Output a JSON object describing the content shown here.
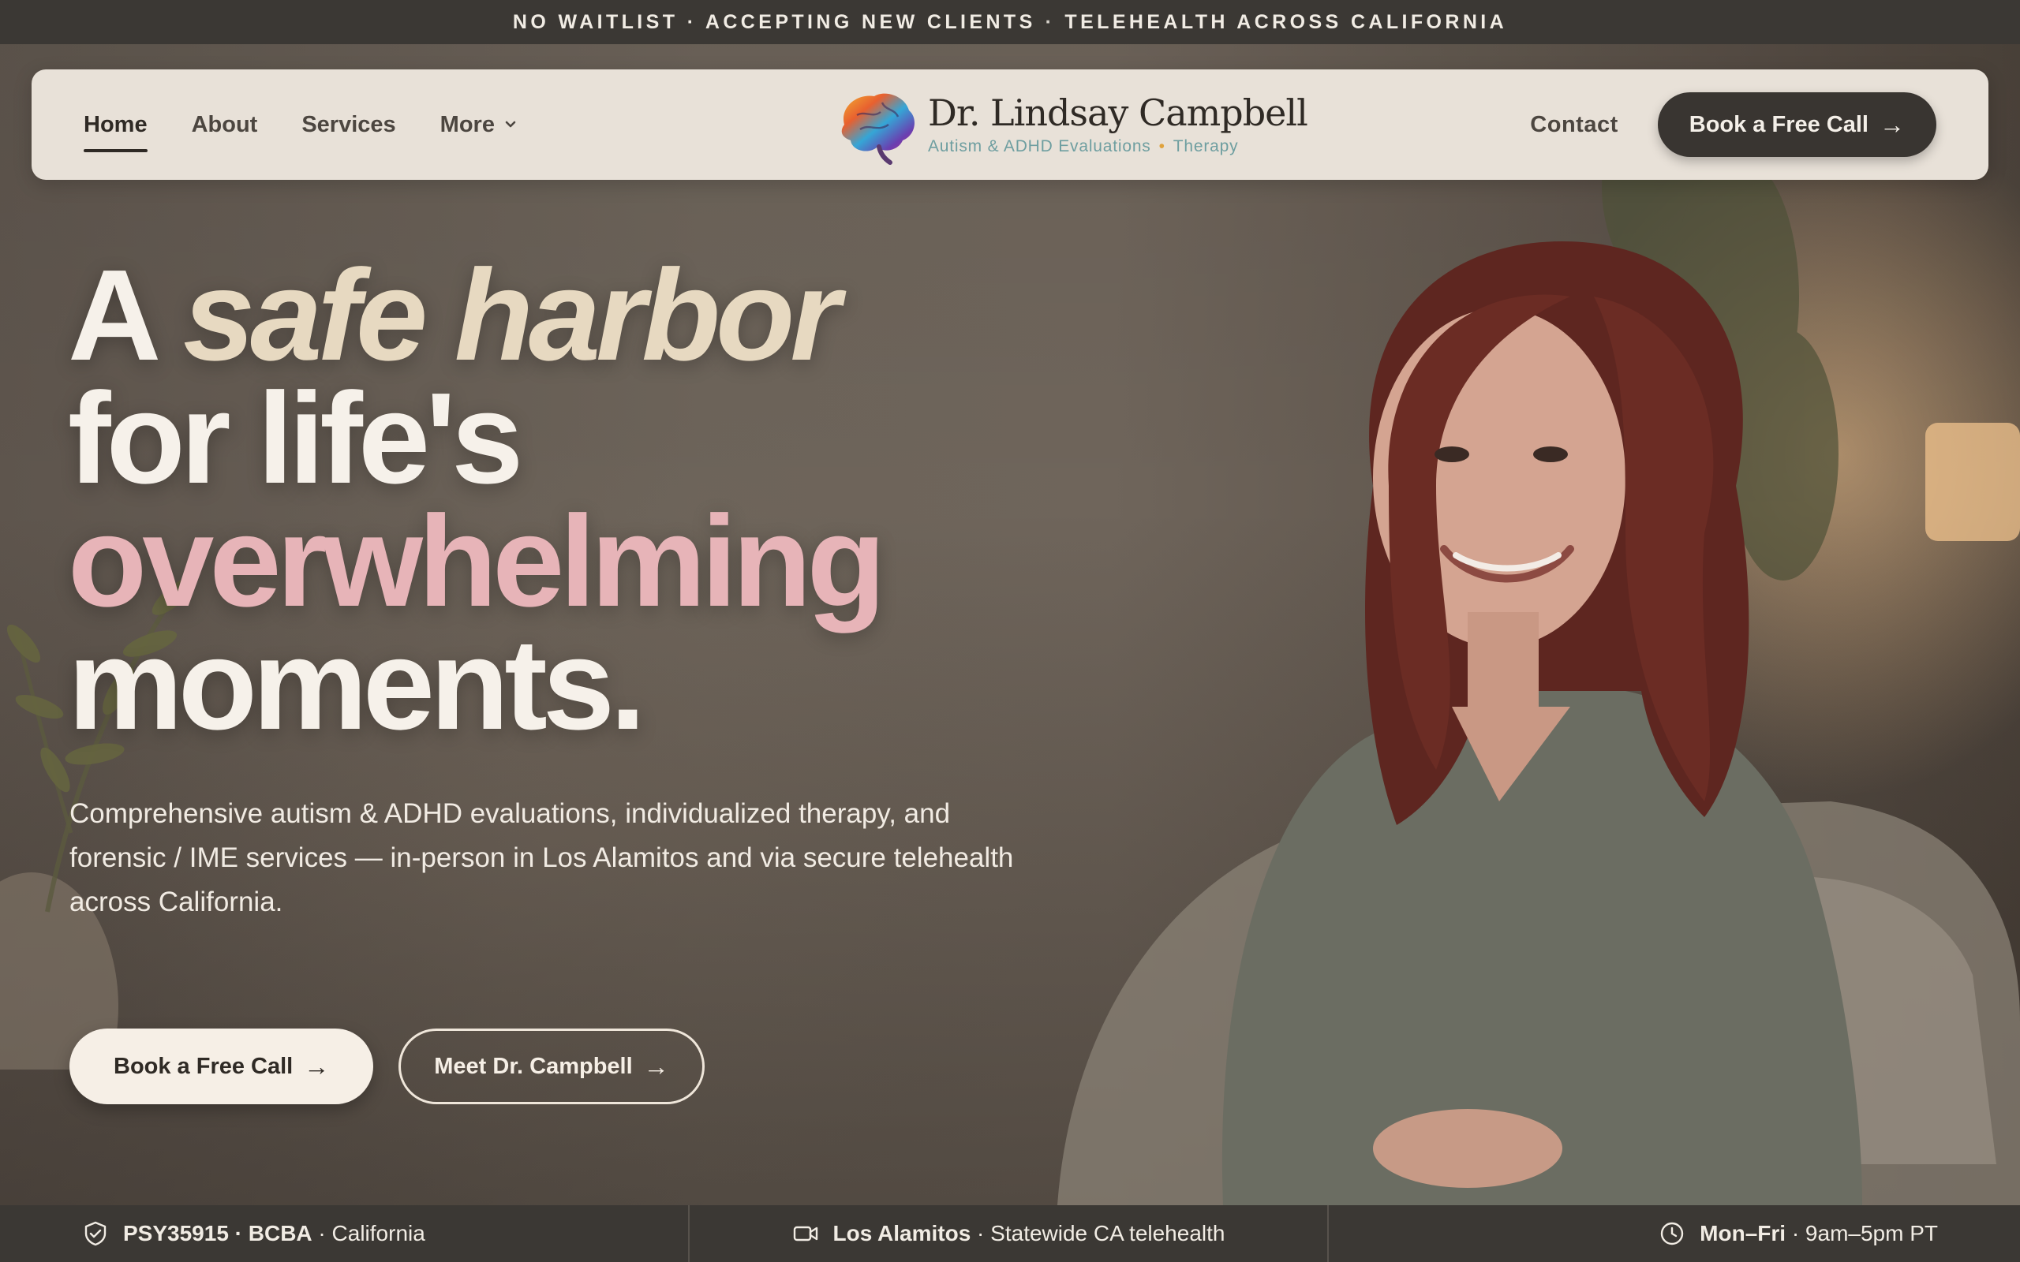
{
  "announcement": {
    "part1": "NO WAITLIST · ACCEPTING NEW CLIENTS",
    "separator": "·",
    "part2": "TELEHEALTH ACROSS CALIFORNIA"
  },
  "nav": {
    "links": [
      {
        "label": "Home",
        "active": true
      },
      {
        "label": "About"
      },
      {
        "label": "Services"
      },
      {
        "label": "More"
      }
    ],
    "brand": {
      "name": "Dr. Lindsay Campbell",
      "tag1": "Autism & ADHD Evaluations",
      "tag_dot": "•",
      "tag2": "Therapy",
      "logo_icon": "brain-icon"
    },
    "contact": "Contact",
    "cta": "Book a Free Call",
    "arrow": "→"
  },
  "hero": {
    "line1_a": "A ",
    "line1_b": "safe harbor",
    "line2": "for life's",
    "line3": "overwhelming",
    "line4": "moments.",
    "subtext": "Comprehensive autism & ADHD evaluations, individualized therapy, and forensic / IME services — in-person in Los Alamitos and via secure telehealth across California.",
    "primary_cta": "Book a Free Call",
    "secondary_cta": "Meet Dr. Campbell",
    "arrow": "→",
    "colors": {
      "sand": "#e7d9c1",
      "pink": "#e7b4b8",
      "cream": "#f6f1ea"
    }
  },
  "infobar": {
    "item1": {
      "bold": "PSY35915 · BCBA",
      "rest": " · California",
      "icon": "shield-check-icon"
    },
    "item2": {
      "bold": "Los Alamitos",
      "rest": " · Statewide CA telehealth",
      "icon": "video-camera-icon"
    },
    "item3": {
      "bold": "Mon–Fri",
      "rest": " · 9am–5pm PT",
      "icon": "clock-icon"
    }
  }
}
